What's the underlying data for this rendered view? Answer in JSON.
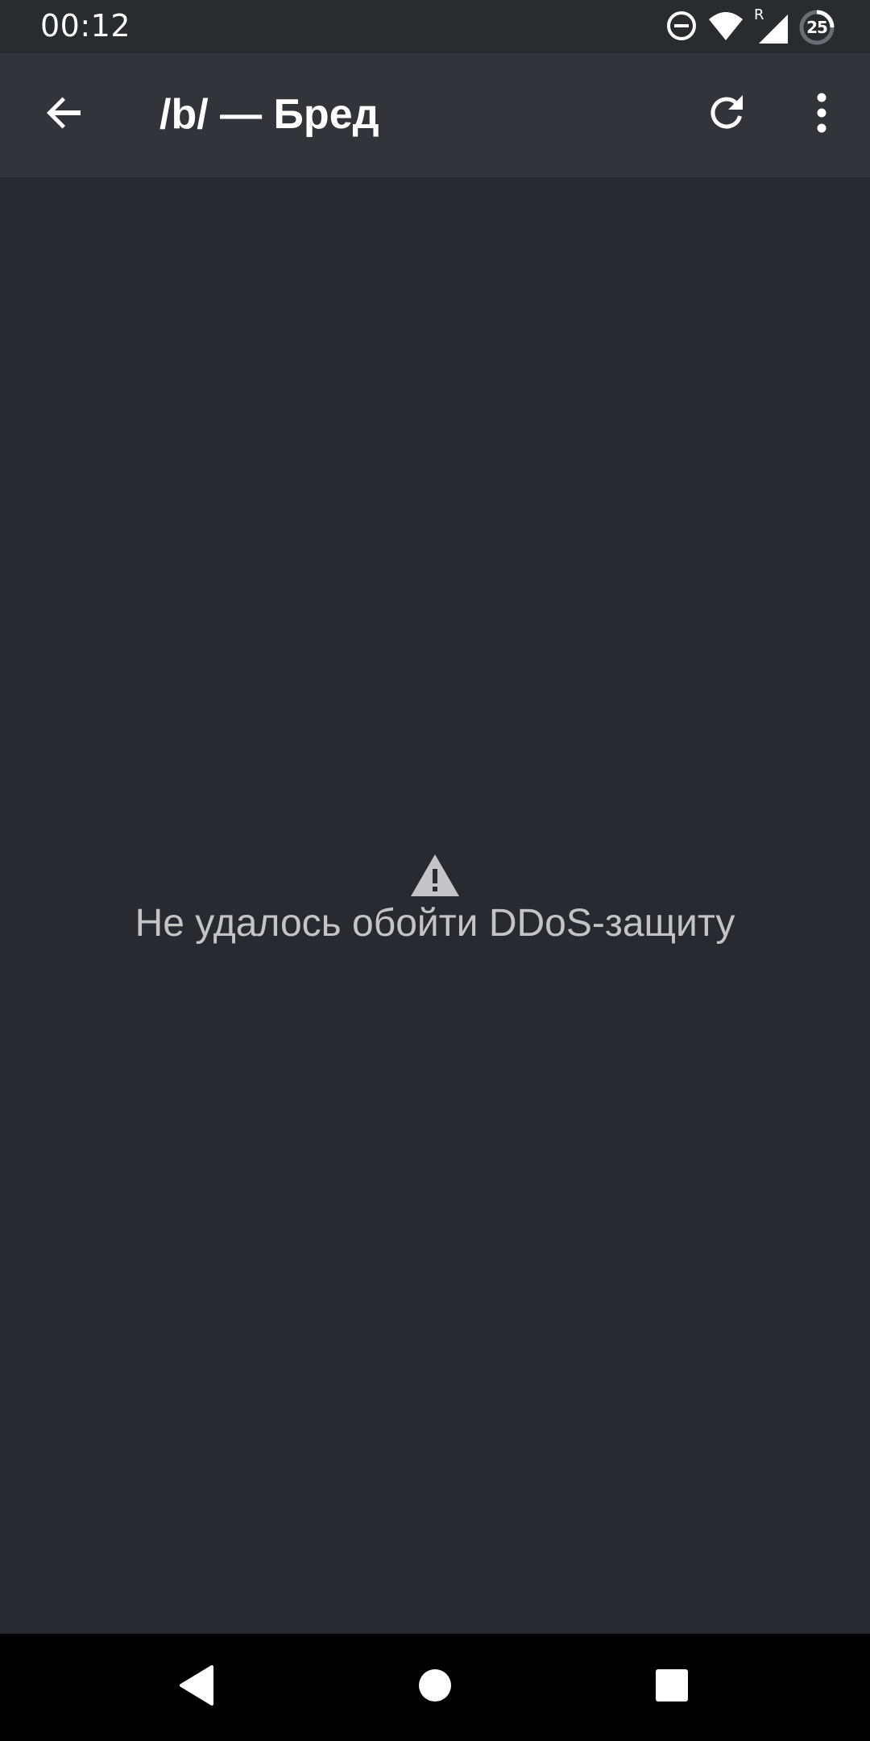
{
  "status_bar": {
    "time": "00:12",
    "battery_level": "25",
    "network_roaming_label": "R",
    "icons": [
      "do-not-disturb-icon",
      "wifi-icon",
      "cell-signal-icon",
      "battery-icon"
    ]
  },
  "app_bar": {
    "title": "/b/ — Бред",
    "icons": [
      "back-arrow-icon",
      "refresh-icon",
      "more-vert-icon"
    ]
  },
  "content": {
    "error_icon": "warning-icon",
    "error_message": "Не удалось обойти DDoS-защиту"
  },
  "nav_bar": {
    "icons": [
      "nav-back-icon",
      "nav-home-icon",
      "nav-recents-icon"
    ]
  },
  "colors": {
    "background": "#292a2f",
    "app_bar": "#333439",
    "status_bar": "#2a2b2f",
    "error_text": "#c4c4c6",
    "nav_bar": "#000000"
  }
}
